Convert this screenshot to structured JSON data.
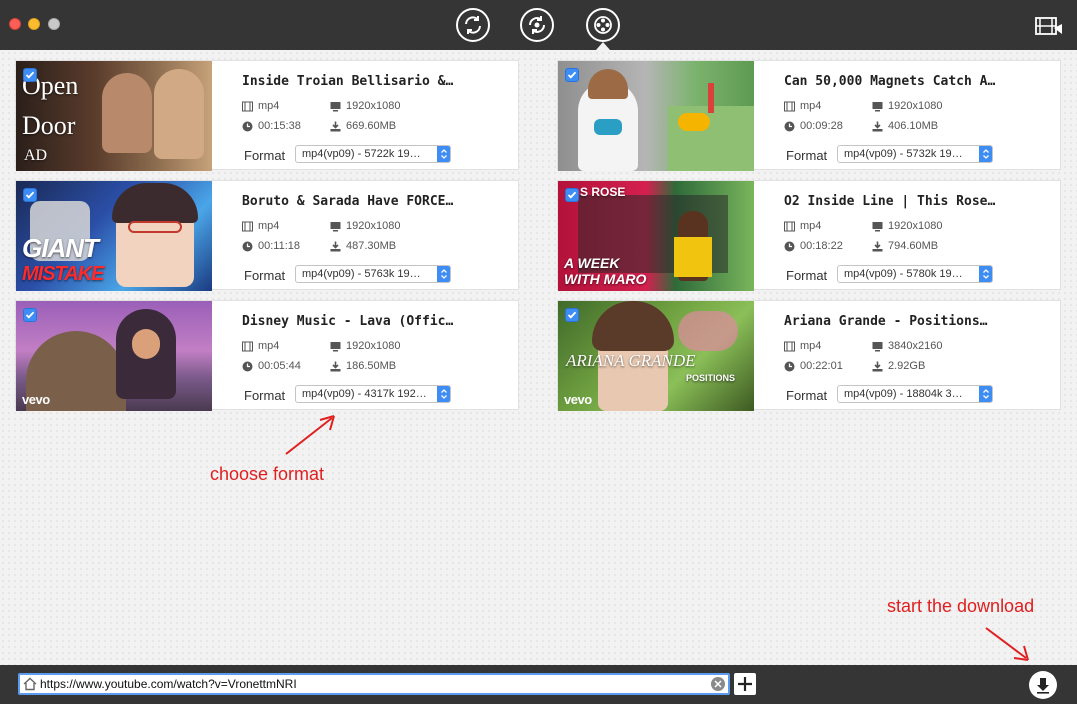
{
  "toolbar": {
    "tabs": [
      {
        "icon": "convert-icon"
      },
      {
        "icon": "sync-icon"
      },
      {
        "icon": "video-download-icon",
        "active": true
      }
    ],
    "right_icon": "film-icon"
  },
  "format_label": "Format",
  "videos": [
    {
      "title": "Inside Troian Bellisario &…",
      "container": "mp4",
      "resolution": "1920x1080",
      "duration": "00:15:38",
      "size": "669.60MB",
      "format": "mp4(vp09) - 5722k 19…",
      "thumb_text": [
        "Open",
        "Door",
        "AD"
      ],
      "checked": true
    },
    {
      "title": "Can 50,000 Magnets Catch A…",
      "container": "mp4",
      "resolution": "1920x1080",
      "duration": "00:09:28",
      "size": "406.10MB",
      "format": "mp4(vp09) - 5732k 19…",
      "checked": true
    },
    {
      "title": "Boruto & Sarada Have FORCE…",
      "container": "mp4",
      "resolution": "1920x1080",
      "duration": "00:11:18",
      "size": "487.30MB",
      "format": "mp4(vp09) - 5763k 19…",
      "thumb_text": [
        "GIANT",
        "MISTAKE"
      ],
      "checked": true
    },
    {
      "title": "O2 Inside Line | This Rose…",
      "container": "mp4",
      "resolution": "1920x1080",
      "duration": "00:18:22",
      "size": "794.60MB",
      "format": "mp4(vp09) - 5780k 19…",
      "thumb_text": [
        "S ROSE",
        "A WEEK",
        "WITH MARO"
      ],
      "checked": true
    },
    {
      "title": "Disney Music - Lava (Offic…",
      "container": "mp4",
      "resolution": "1920x1080",
      "duration": "00:05:44",
      "size": "186.50MB",
      "format": "mp4(vp09) - 4317k 192…",
      "thumb_text": [
        "vevo"
      ],
      "checked": true
    },
    {
      "title": "Ariana Grande - Positions…",
      "container": "mp4",
      "resolution": "3840x2160",
      "duration": "00:22:01",
      "size": "2.92GB",
      "format": "mp4(vp09) - 18804k 3…",
      "thumb_text": [
        "ARIANA GRANDE",
        "POSITIONS",
        "vevo"
      ],
      "checked": true
    }
  ],
  "annotations": {
    "choose_format": "choose format",
    "start_download": "start the download"
  },
  "url_bar": {
    "value": "https://www.youtube.com/watch?v=VronettmNRI"
  },
  "colors": {
    "accent": "#3d8df5",
    "annotation": "#e02020",
    "titlebar": "#353535"
  }
}
